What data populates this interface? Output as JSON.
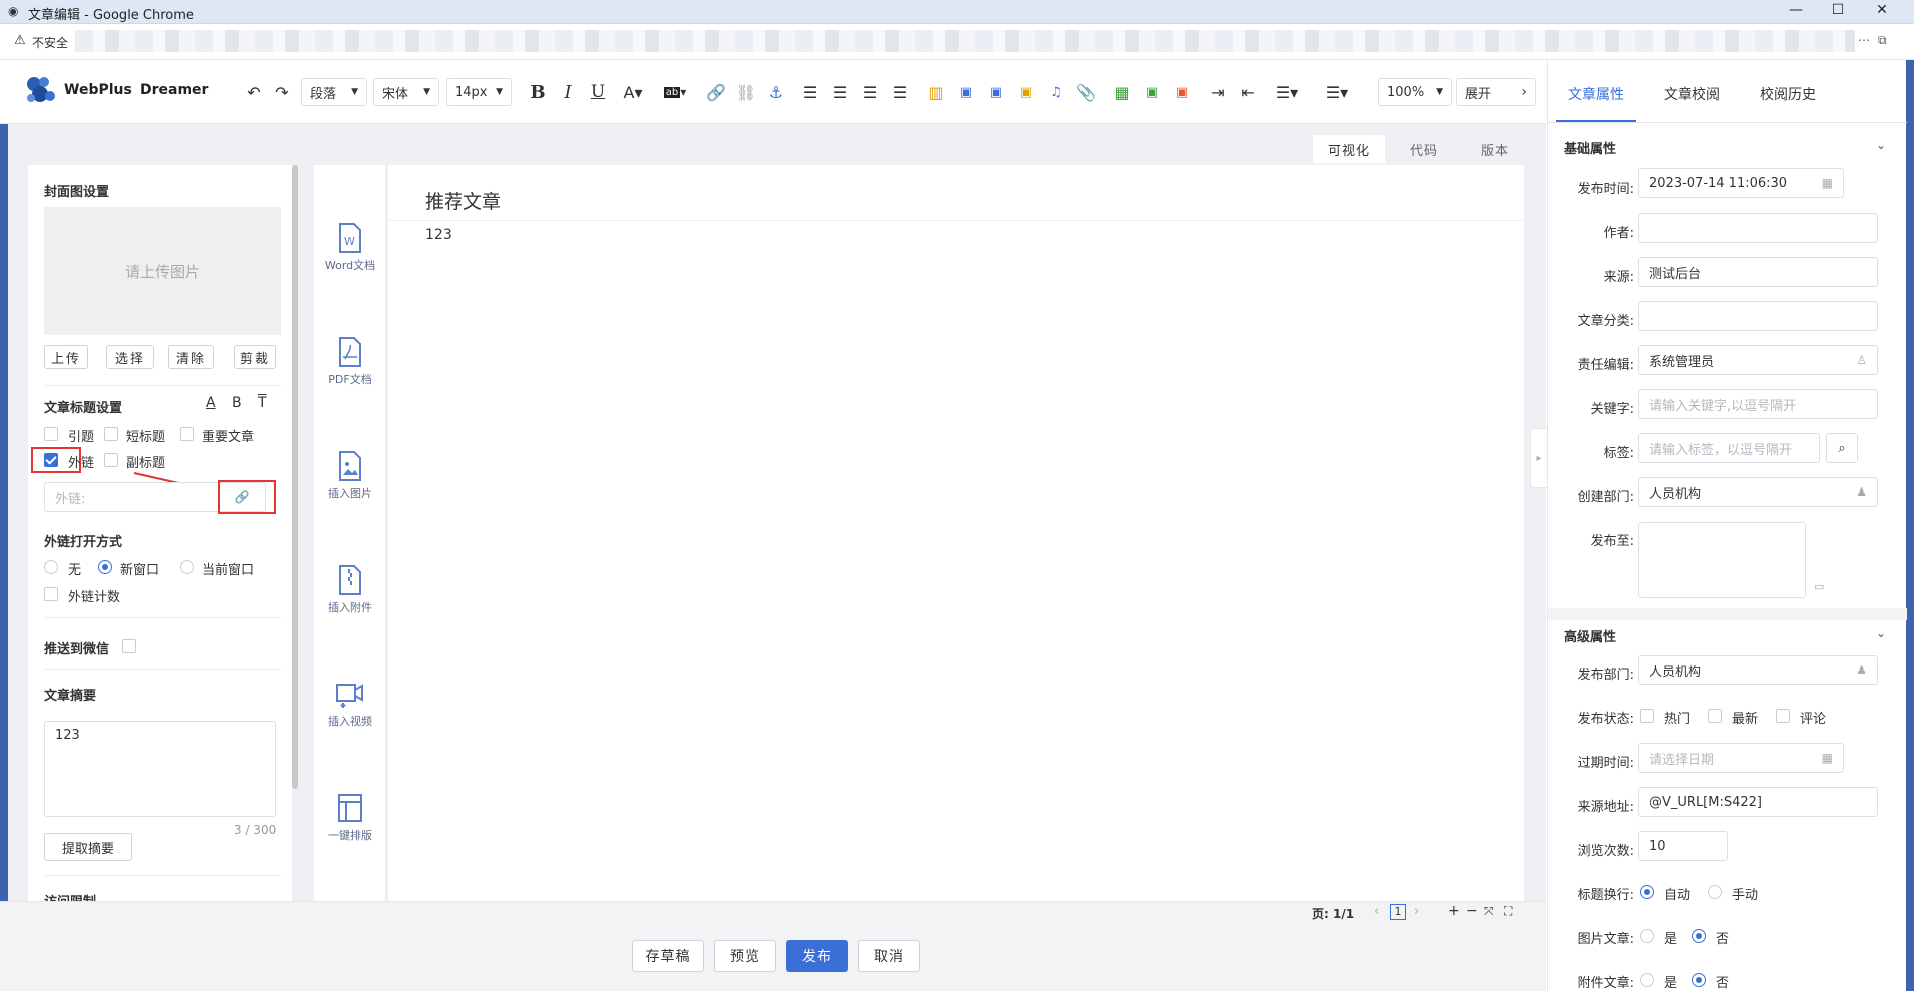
{
  "window": {
    "title": "文章编辑 - Google Chrome",
    "insecure": "不安全"
  },
  "brand": {
    "name": "WebPlus",
    "sub": "Dreamer"
  },
  "toolbar": {
    "paragraph": "段落",
    "font": "宋体",
    "size": "14px",
    "zoom": "100%",
    "expand": "展开"
  },
  "view_tabs": {
    "visual": "可视化",
    "code": "代码",
    "version": "版本"
  },
  "left": {
    "cover_title": "封面图设置",
    "upload_placeholder": "请上传图片",
    "buttons": {
      "upload": "上传",
      "select": "选择",
      "clear": "清除",
      "crop": "剪裁"
    },
    "title_settings": "文章标题设置",
    "title_icons": {
      "a": "A",
      "b": "B",
      "t": "T"
    },
    "checks": {
      "intro": "引题",
      "short": "短标题",
      "important": "重要文章",
      "external": "外链",
      "subtitle": "副标题"
    },
    "ext_placeholder": "外链:",
    "open_mode": "外链打开方式",
    "radios": {
      "none": "无",
      "new": "新窗口",
      "current": "当前窗口"
    },
    "ext_count": "外链计数",
    "wechat": "推送到微信",
    "summary_title": "文章摘要",
    "summary_value": "123",
    "summary_count": "3 / 300",
    "extract": "提取摘要",
    "access": "访问限制"
  },
  "sidetools": [
    {
      "label": "Word文档"
    },
    {
      "label": "PDF文档"
    },
    {
      "label": "插入图片"
    },
    {
      "label": "插入附件"
    },
    {
      "label": "插入视频"
    },
    {
      "label": "一键排版"
    }
  ],
  "doc": {
    "title": "推荐文章",
    "body": "123"
  },
  "status": {
    "page_label": "页: 1/1",
    "page_num": "1"
  },
  "bottom": {
    "draft": "存草稿",
    "preview": "预览",
    "publish": "发布",
    "cancel": "取消"
  },
  "right": {
    "tabs": [
      "文章属性",
      "文章校阅",
      "校阅历史"
    ],
    "basic": "基础属性",
    "fields": {
      "publish_time": {
        "label": "发布时间:",
        "value": "2023-07-14 11:06:30"
      },
      "author": {
        "label": "作者:",
        "value": ""
      },
      "source": {
        "label": "来源:",
        "value": "测试后台"
      },
      "category": {
        "label": "文章分类:",
        "value": ""
      },
      "editor": {
        "label": "责任编辑:",
        "value": "系统管理员"
      },
      "keywords": {
        "label": "关键字:",
        "placeholder": "请输入关键字,以逗号隔开"
      },
      "tags": {
        "label": "标签:",
        "placeholder": "请输入标签，以逗号隔开"
      },
      "dept": {
        "label": "创建部门:",
        "value": "人员机构"
      },
      "publish_to": {
        "label": "发布至:"
      }
    },
    "advanced": "高级属性",
    "adv": {
      "pub_dept": {
        "label": "发布部门:",
        "value": "人员机构"
      },
      "pub_status": {
        "label": "发布状态:",
        "hot": "热门",
        "latest": "最新",
        "comment": "评论"
      },
      "expire": {
        "label": "过期时间:",
        "placeholder": "请选择日期"
      },
      "source_url": {
        "label": "来源地址:",
        "value": "@V_URL[M:S422]"
      },
      "views": {
        "label": "浏览次数:",
        "value": "10"
      },
      "title_wrap": {
        "label": "标题换行:",
        "auto": "自动",
        "manual": "手动"
      },
      "image_article": {
        "label": "图片文章:",
        "yes": "是",
        "no": "否"
      },
      "attach_article": {
        "label": "附件文章:",
        "yes": "是",
        "no": "否"
      }
    }
  },
  "colors": {
    "accent": "#3a6fd8",
    "highlight": "#e53333"
  }
}
